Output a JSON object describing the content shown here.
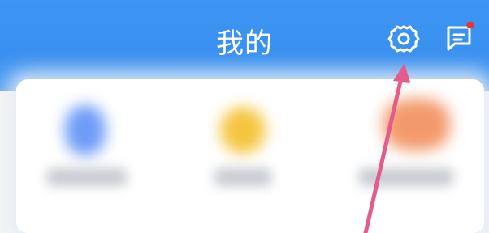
{
  "header": {
    "title": "我的",
    "background": "#3a90f0",
    "icons": {
      "settings": "gear-icon",
      "messages": "message-icon",
      "notification_dot_color": "#e8333a"
    }
  },
  "shortcuts": [
    {
      "icon": "blue-shortcut-icon",
      "color": "#6e9cf6"
    },
    {
      "icon": "yellow-shortcut-icon",
      "color": "#f5c53f"
    },
    {
      "icon": "orange-shortcut-icon",
      "color": "#f39a6c"
    }
  ],
  "annotation": {
    "arrow_color": "#e45c8c",
    "points_to": "gear-icon"
  }
}
